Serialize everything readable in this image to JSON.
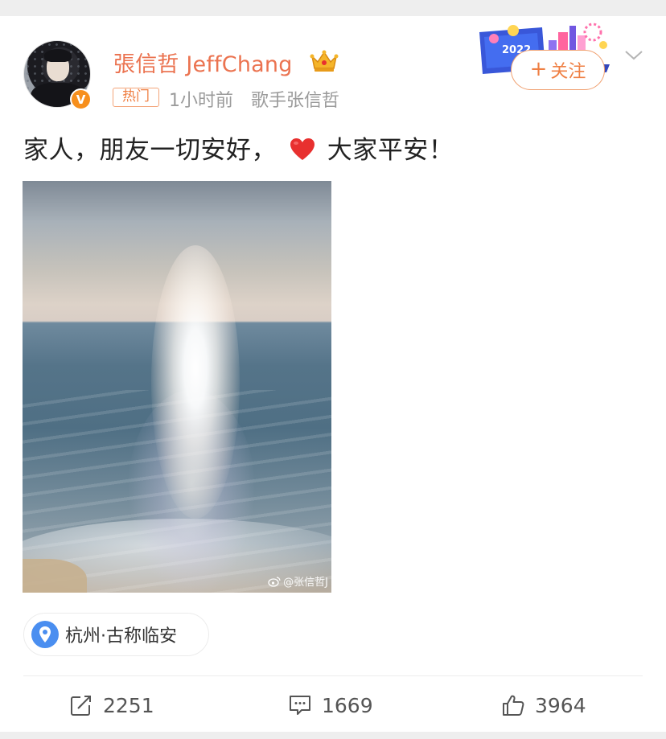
{
  "post": {
    "author": {
      "name": "張信哲 JeffChang",
      "verified_mark": "V"
    },
    "hot_tag": "热门",
    "time": "1小时前",
    "source": "歌手张信哲",
    "follow_label": "关注",
    "follow_plus": "+",
    "text_part1": "家人，朋友一切安好，",
    "text_part2": "大家平安！",
    "image_watermark": "@张信哲J",
    "location": "杭州·古称临安",
    "promo_badge_text": "2022"
  },
  "actions": {
    "reposts": "2251",
    "comments": "1669",
    "likes": "3964"
  },
  "icons": {
    "crown": "crown-icon",
    "heart": "red-heart-icon",
    "location": "location-pin-icon",
    "repost": "share-icon",
    "comment": "comment-icon",
    "like": "thumbs-up-icon",
    "more": "chevron-down-icon"
  },
  "colors": {
    "username": "#eb7350",
    "accent_orange": "#ef7f43",
    "meta_gray": "#9b9b9b",
    "pin_blue": "#4a8ef0",
    "heart_red": "#e8302f"
  }
}
